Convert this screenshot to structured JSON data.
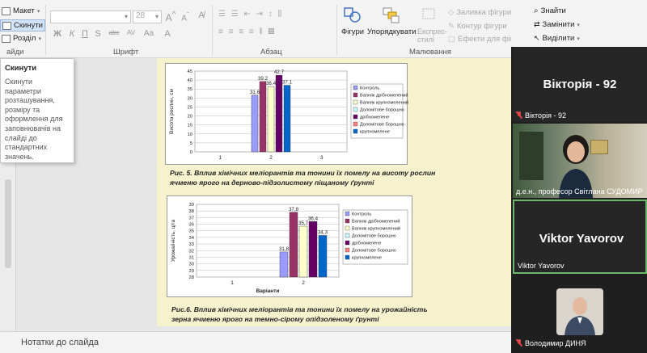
{
  "ribbon": {
    "layout_label": "Макет",
    "reset_label": "Скинути",
    "section_label": "Розділ",
    "font_name": "",
    "font_size": "28",
    "groups": {
      "font": "Шрифт",
      "paragraph": "Абзац",
      "drawing": "Малювання",
      "slides_suffix": "айди"
    },
    "shapes_label": "Фігури",
    "arrange_label": "Упорядкувати",
    "quick_styles_label": "Експрес-стилі",
    "shape_fill_label": "Заливка фігури",
    "shape_outline_label": "Контур фігури",
    "shape_effects_label": "Ефекти для фігур",
    "find_label": "Знайти",
    "replace_label": "Замінити",
    "select_label": "Виділити",
    "format_buttons": [
      "Ж",
      "К",
      "П",
      "S",
      "abc",
      "AV",
      "Aa",
      "A"
    ]
  },
  "tooltip": {
    "title": "Скинути",
    "description": "Скинути параметри розташування, розміру та оформлення для заповнювачів на слайді до стандартних значень."
  },
  "notes": {
    "label": "Нотатки до слайда"
  },
  "meeting": {
    "tile1": {
      "big_name": "Вікторія - 92",
      "name": "Вікторія - 92"
    },
    "tile2": {
      "name": "д.е.н., професор Світлана СУДОМИР"
    },
    "tile3": {
      "big_name": "Viktor Yavorov",
      "name": "Viktor Yavorov"
    },
    "tile4": {
      "name": "Володимир ДИНЯ"
    }
  },
  "slide": {
    "caption1_line1": "Рис. 5. Вплив хімічних меліорантів та тонини їх помелу на висоту рослин",
    "caption1_line2": "ячменю ярого на дерново-підзолистому піщаному ґрунті",
    "caption2_line1": "Рис.6. Вплив хімічних меліорантів та тонини їх помелу на урожайність",
    "caption2_line2": "зерна ячменю ярого на темно-сірому опідзоленому ґрунті"
  },
  "chart_data": [
    {
      "type": "bar",
      "ylabel": "Висота рослин, см",
      "xlabel": "",
      "categories": [
        "1",
        "2",
        "3"
      ],
      "ylim": [
        0,
        45
      ],
      "yticks": [
        "45",
        "40",
        "35",
        "30",
        "25",
        "20",
        "15",
        "10",
        "5",
        "0"
      ],
      "series": [
        {
          "name": "Контроль",
          "value": 31.6,
          "label": "31.6",
          "color": "#9b9bff"
        },
        {
          "name": "Вапняк дрібномелений",
          "value": 39.2,
          "label": "39.2",
          "color": "#993366"
        },
        {
          "name": "Вапняк крупномелений",
          "value": 36.4,
          "label": "36.4",
          "color": "#ffffcc"
        },
        {
          "name": "Доломітове борошно",
          "value": null,
          "label": "",
          "color": "#ccffff"
        },
        {
          "name": "дрібномелене",
          "value": 42.7,
          "label": "42.7",
          "color": "#660066"
        },
        {
          "name": "Доломітове борошно",
          "value": null,
          "label": "",
          "color": "#ff8080"
        },
        {
          "name": "крупномелене",
          "value": 37.1,
          "label": "37.1",
          "color": "#0066cc"
        }
      ]
    },
    {
      "type": "bar",
      "ylabel": "Урожайність, ц/га",
      "xlabel": "Варіанти",
      "categories": [
        "1",
        "2"
      ],
      "ylim": [
        28,
        39
      ],
      "yticks": [
        "39",
        "38",
        "37",
        "36",
        "35",
        "34",
        "33",
        "32",
        "31",
        "30",
        "29",
        "28"
      ],
      "series": [
        {
          "name": "Контроль",
          "value": 31.8,
          "label": "31,8",
          "color": "#9b9bff"
        },
        {
          "name": "Вапняк дрібномелений",
          "value": 37.8,
          "label": "37,8",
          "color": "#993366"
        },
        {
          "name": "Вапняк крупномелений",
          "value": 35.7,
          "label": "35,7",
          "color": "#ffffcc"
        },
        {
          "name": "Доломітове борошно",
          "value": null,
          "label": "",
          "color": "#ccffff"
        },
        {
          "name": "дрібномелене",
          "value": 36.4,
          "label": "36,4",
          "color": "#660066"
        },
        {
          "name": "Доломітове борошно",
          "value": null,
          "label": "",
          "color": "#ff8080"
        },
        {
          "name": "крупномелене",
          "value": 34.3,
          "label": "34,3",
          "color": "#0066cc"
        }
      ]
    }
  ]
}
